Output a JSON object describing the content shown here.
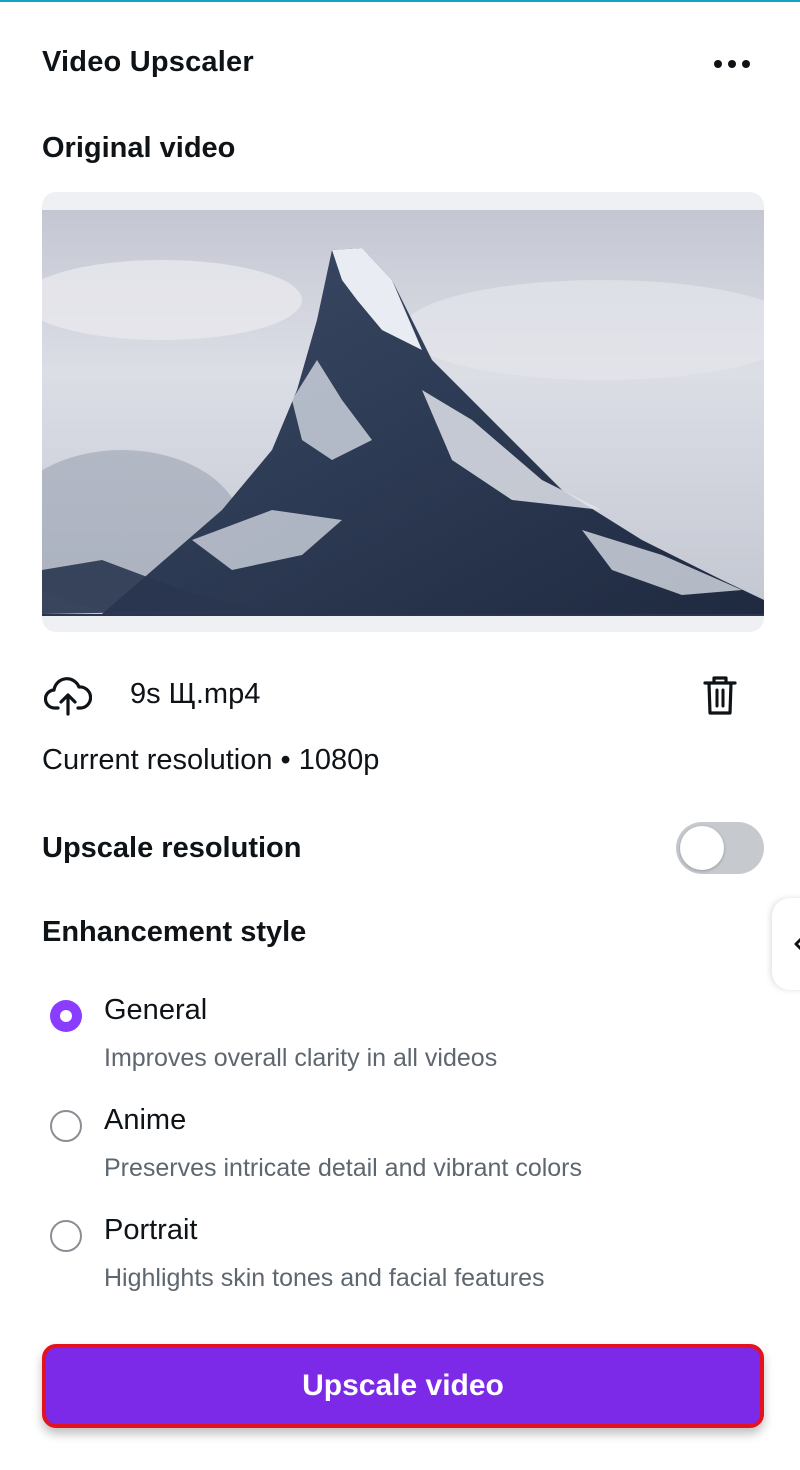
{
  "panel": {
    "title": "Video Upscaler",
    "more_icon": "more-horizontal-icon"
  },
  "original": {
    "label": "Original video",
    "file_name": "9s Щ.mp4",
    "upload_icon": "cloud-upload-icon",
    "delete_icon": "trash-icon"
  },
  "resolution": {
    "text": "Current resolution • 1080p"
  },
  "upscale": {
    "label": "Upscale resolution",
    "enabled": false
  },
  "enhancement": {
    "label": "Enhancement style",
    "selected": "General",
    "options": [
      {
        "title": "General",
        "description": "Improves overall clarity in all videos"
      },
      {
        "title": "Anime",
        "description": "Preserves intricate detail and vibrant colors"
      },
      {
        "title": "Portrait",
        "description": "Highlights skin tones and facial features"
      }
    ]
  },
  "action": {
    "label": "Upscale video"
  },
  "colors": {
    "accent": "#8b3dff",
    "button": "#7d2ae8",
    "highlight_border": "#e4121f",
    "top_line": "#13a3c4"
  }
}
